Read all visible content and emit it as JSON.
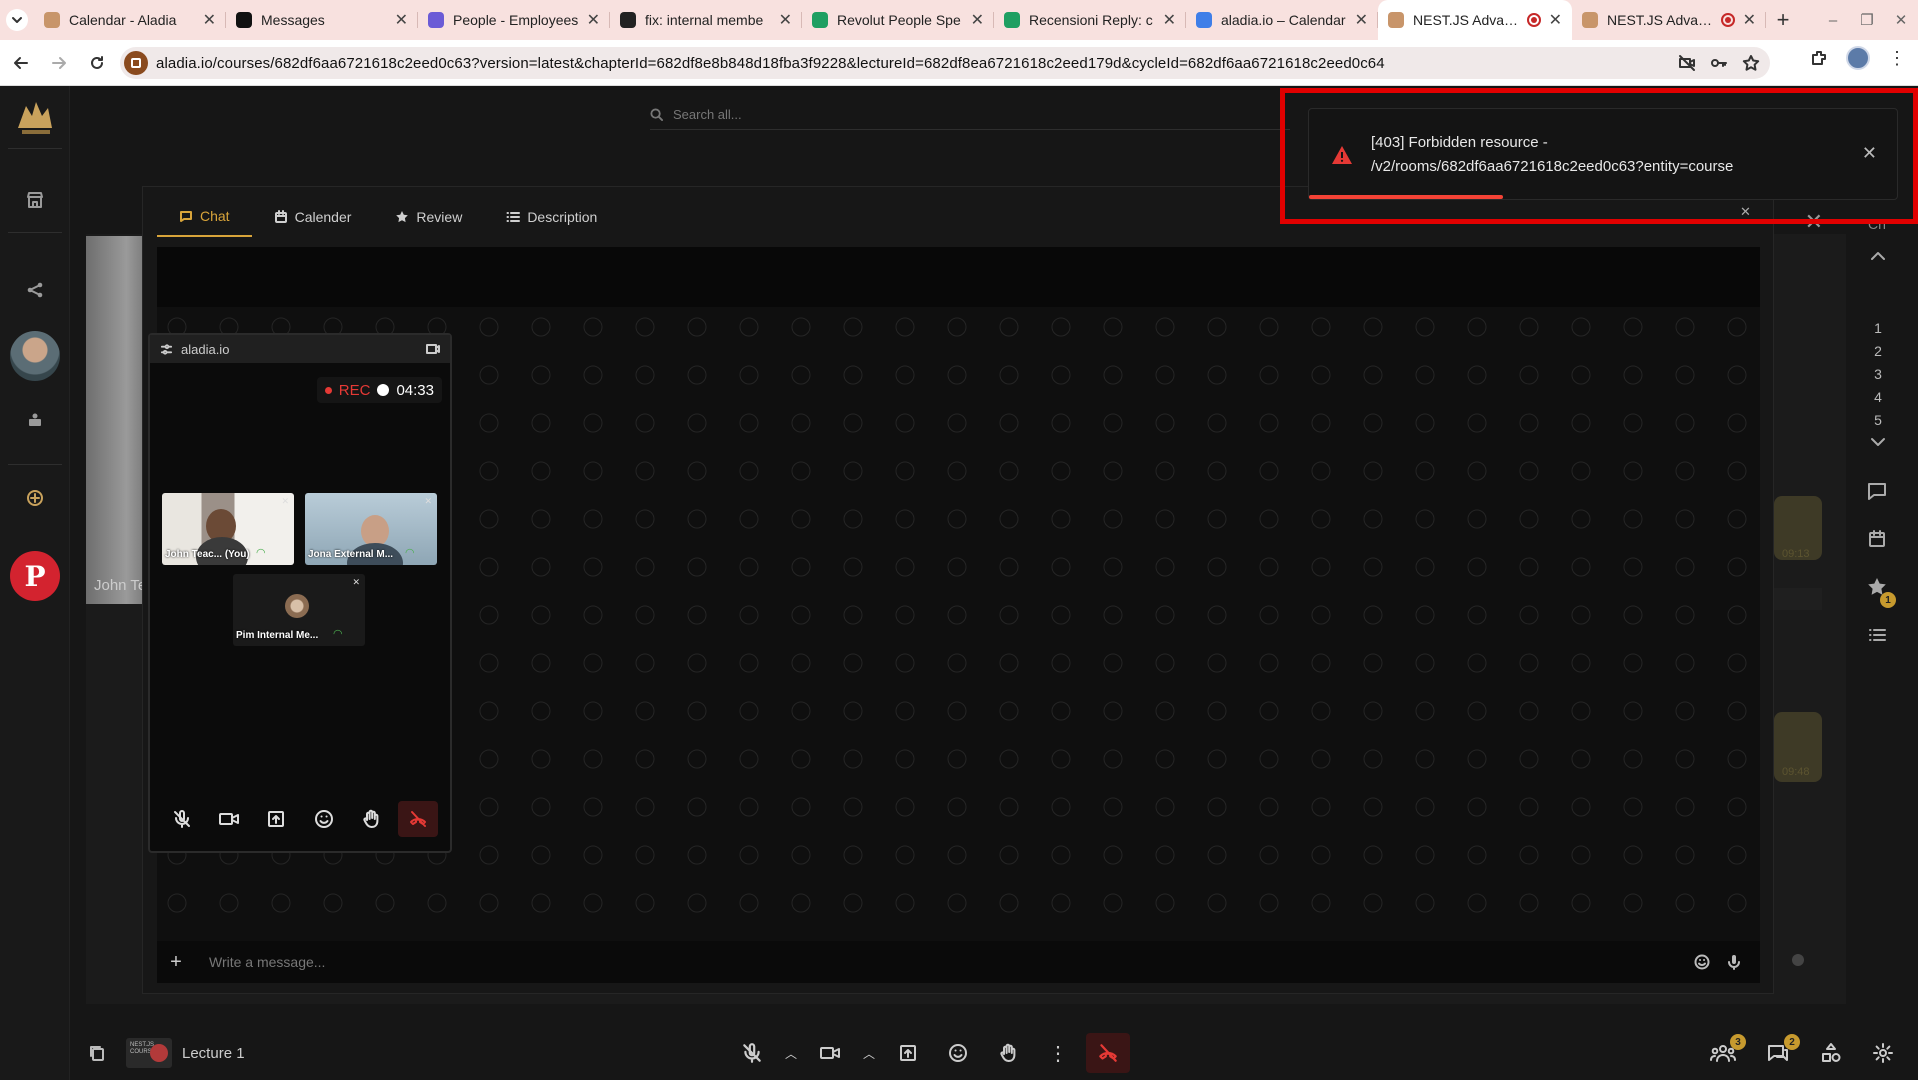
{
  "browser": {
    "tabs": [
      {
        "title": "Calendar - Aladia",
        "fav": "#c8956a",
        "w": 192
      },
      {
        "title": "Messages",
        "fav": "#111111",
        "w": 192
      },
      {
        "title": "People - Employees",
        "fav": "#6b5bd6",
        "w": 192
      },
      {
        "title": "fix: internal membe",
        "fav": "#222222",
        "w": 192
      },
      {
        "title": "Revolut People Spe",
        "fav": "#1f9f62",
        "w": 192
      },
      {
        "title": "Recensioni Reply: c",
        "fav": "#1f9f62",
        "w": 192
      },
      {
        "title": "aladia.io – Calendar",
        "fav": "#3f7ee8",
        "w": 192
      },
      {
        "title": "NEST.JS Advance",
        "fav": "#c8956a",
        "w": 194,
        "active": true,
        "recording": true
      },
      {
        "title": "NEST.JS Advance",
        "fav": "#c8956a",
        "w": 194,
        "recording": true
      }
    ],
    "url": "aladia.io/courses/682df6aa6721618c2eed0c63?version=latest&chapterId=682df8e8b848d18fba3f9228&lectureId=682df8ea6721618c2eed179d&cycleId=682df6aa6721618c2eed0c64"
  },
  "app": {
    "search_placeholder": "Search all...",
    "bg_participant": "John Te",
    "chapter_label": "Ch",
    "chapters": [
      "1",
      "2",
      "3",
      "4",
      "5"
    ],
    "review_badge": "1",
    "ghost_times": [
      "09:13",
      "09:48"
    ]
  },
  "modal": {
    "tabs": [
      {
        "label": "Chat",
        "icon": "chat-icon",
        "active": true
      },
      {
        "label": "Calender",
        "icon": "calendar-icon"
      },
      {
        "label": "Review",
        "icon": "star-icon"
      },
      {
        "label": "Description",
        "icon": "list-icon"
      }
    ],
    "composer_placeholder": "Write a message..."
  },
  "video_call": {
    "domain": "aladia.io",
    "rec_label": "REC",
    "time": "04:33",
    "participants": [
      {
        "name": "John Teac... (You)"
      },
      {
        "name": "Jona External M..."
      },
      {
        "name": "Pim Internal Me..."
      }
    ]
  },
  "toast": {
    "line1": "[403] Forbidden resource -",
    "line2": "/v2/rooms/682df6aa6721618c2eed0c63?entity=course",
    "progress": 0.33,
    "color": "#f44336"
  },
  "bottom": {
    "course_thumb_text": "NEST.JS COURSE",
    "lecture": "Lecture 1",
    "people_badge": "3",
    "chat_badge": "2"
  },
  "colors": {
    "accent": "#d8a43a",
    "danger": "#e53935",
    "highlight": "#e10000"
  }
}
